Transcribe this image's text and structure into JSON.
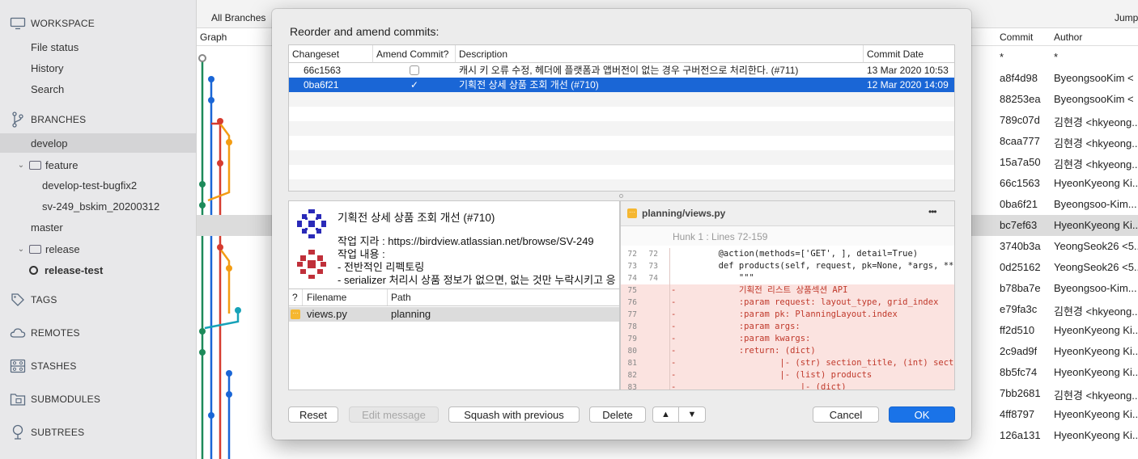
{
  "sidebar": {
    "workspace_label": "WORKSPACE",
    "workspace_items": [
      "File status",
      "History",
      "Search"
    ],
    "branches_label": "BRANCHES",
    "branches": {
      "develop": "develop",
      "feature_folder": "feature",
      "feature_items": [
        "develop-test-bugfix2",
        "sv-249_bskim_20200312"
      ],
      "master": "master",
      "release_folder": "release",
      "release_items": [
        "release-test"
      ]
    },
    "tags_label": "TAGS",
    "remotes_label": "REMOTES",
    "stashes_label": "STASHES",
    "submodules_label": "SUBMODULES",
    "subtrees_label": "SUBTREES"
  },
  "history": {
    "filter_label": "All Branches",
    "jump_label": "Jump",
    "col_graph": "Graph",
    "col_commit": "Commit",
    "col_author": "Author",
    "rows": [
      {
        "commit": "*",
        "author": "*"
      },
      {
        "commit": "a8f4d98",
        "author": "ByeongsooKim <"
      },
      {
        "commit": "88253ea",
        "author": "ByeongsooKim <"
      },
      {
        "commit": "789c07d",
        "author": "김현경 <hkyeong..."
      },
      {
        "commit": "8caa777",
        "author": "김현경 <hkyeong..."
      },
      {
        "commit": "15a7a50",
        "author": "김현경 <hkyeong..."
      },
      {
        "commit": "66c1563",
        "author": "HyeonKyeong Ki..."
      },
      {
        "commit": "0ba6f21",
        "author": "Byeongsoo-Kim..."
      },
      {
        "commit": "bc7ef63",
        "author": "HyeonKyeong Ki..."
      },
      {
        "commit": "3740b3a",
        "author": "YeongSeok26 <5..."
      },
      {
        "commit": "0d25162",
        "author": "YeongSeok26 <5..."
      },
      {
        "commit": "b78ba7e",
        "author": "Byeongsoo-Kim..."
      },
      {
        "commit": "e79fa3c",
        "author": "김현경 <hkyeong..."
      },
      {
        "commit": "ff2d510",
        "author": "HyeonKyeong Ki..."
      },
      {
        "commit": "2c9ad9f",
        "author": "HyeonKyeong Ki..."
      },
      {
        "commit": "8b5fc74",
        "author": "HyeonKyeong Ki..."
      },
      {
        "commit": "7bb2681",
        "author": "김현경 <hkyeong..."
      },
      {
        "commit": "4ff8797",
        "author": "HyeonKyeong Ki..."
      },
      {
        "commit": "126a131",
        "author": "HyeonKyeong Ki..."
      }
    ]
  },
  "dialog": {
    "title": "Reorder and amend commits:",
    "columns": {
      "changeset": "Changeset",
      "amend": "Amend Commit?",
      "description": "Description",
      "date": "Commit Date"
    },
    "commits": [
      {
        "changeset": "66c1563",
        "amend": false,
        "description": "캐시 키 오류 수정, 헤더에 플랫폼과 앱버전이 없는 경우 구버전으로 처리한다. (#711)",
        "date": "13 Mar 2020 10:53"
      },
      {
        "changeset": "0ba6f21",
        "amend": true,
        "description": "기획전 상세 상품 조회 개선 (#710)",
        "date": "12 Mar 2020 14:09"
      }
    ],
    "check_mark": "✓",
    "info": {
      "title": "기획전 상세 상품 조회 개선 (#710)",
      "line1": "작업 지라 : https://birdview.atlassian.net/browse/SV-249",
      "line2": "작업 내용 :",
      "line3": "- 전반적인 리펙토링",
      "line4": "- serializer 처리시 상품 정보가 없으면, 없는 것만 누락시키고 응"
    },
    "files": {
      "col_status": "?",
      "col_filename": "Filename",
      "col_path": "Path",
      "rows": [
        {
          "filename": "views.py",
          "path": "planning"
        }
      ]
    },
    "diff": {
      "file": "planning/views.py",
      "more": "•••",
      "hunk": "Hunk 1 : Lines 72-159",
      "lines": [
        {
          "old": "72",
          "new": "72",
          "mark": "",
          "text": "        @action(methods=['GET', ], detail=True)",
          "del": false
        },
        {
          "old": "73",
          "new": "73",
          "mark": "",
          "text": "        def products(self, request, pk=None, *args, **kwargs):",
          "del": false
        },
        {
          "old": "74",
          "new": "74",
          "mark": "",
          "text": "            \"\"\"",
          "del": false
        },
        {
          "old": "75",
          "new": "",
          "mark": "-",
          "text": "            기획전 리스트 상품섹션 API",
          "del": true
        },
        {
          "old": "76",
          "new": "",
          "mark": "-",
          "text": "            :param request: layout_type, grid_index",
          "del": true
        },
        {
          "old": "77",
          "new": "",
          "mark": "-",
          "text": "            :param pk: PlanningLayout.index",
          "del": true
        },
        {
          "old": "78",
          "new": "",
          "mark": "-",
          "text": "            :param args:",
          "del": true
        },
        {
          "old": "79",
          "new": "",
          "mark": "-",
          "text": "            :param kwargs:",
          "del": true
        },
        {
          "old": "80",
          "new": "",
          "mark": "-",
          "text": "            :return: (dict)",
          "del": true
        },
        {
          "old": "81",
          "new": "",
          "mark": "-",
          "text": "                    |- (str) section_title, (int) section_t",
          "del": true
        },
        {
          "old": "82",
          "new": "",
          "mark": "-",
          "text": "                    |- (list) products",
          "del": true
        },
        {
          "old": "83",
          "new": "",
          "mark": "-",
          "text": "                        |- (dict)",
          "del": true
        }
      ]
    },
    "buttons": {
      "reset": "Reset",
      "edit_message": "Edit message",
      "squash": "Squash with previous",
      "delete": "Delete",
      "up": "▲",
      "down": "▼",
      "cancel": "Cancel",
      "ok": "OK"
    }
  },
  "colors": {
    "accent": "#1a66d6",
    "ok_button": "#1a73e8",
    "diff_deleted_bg": "#fbe3e0",
    "diff_deleted_text": "#c0392b"
  }
}
